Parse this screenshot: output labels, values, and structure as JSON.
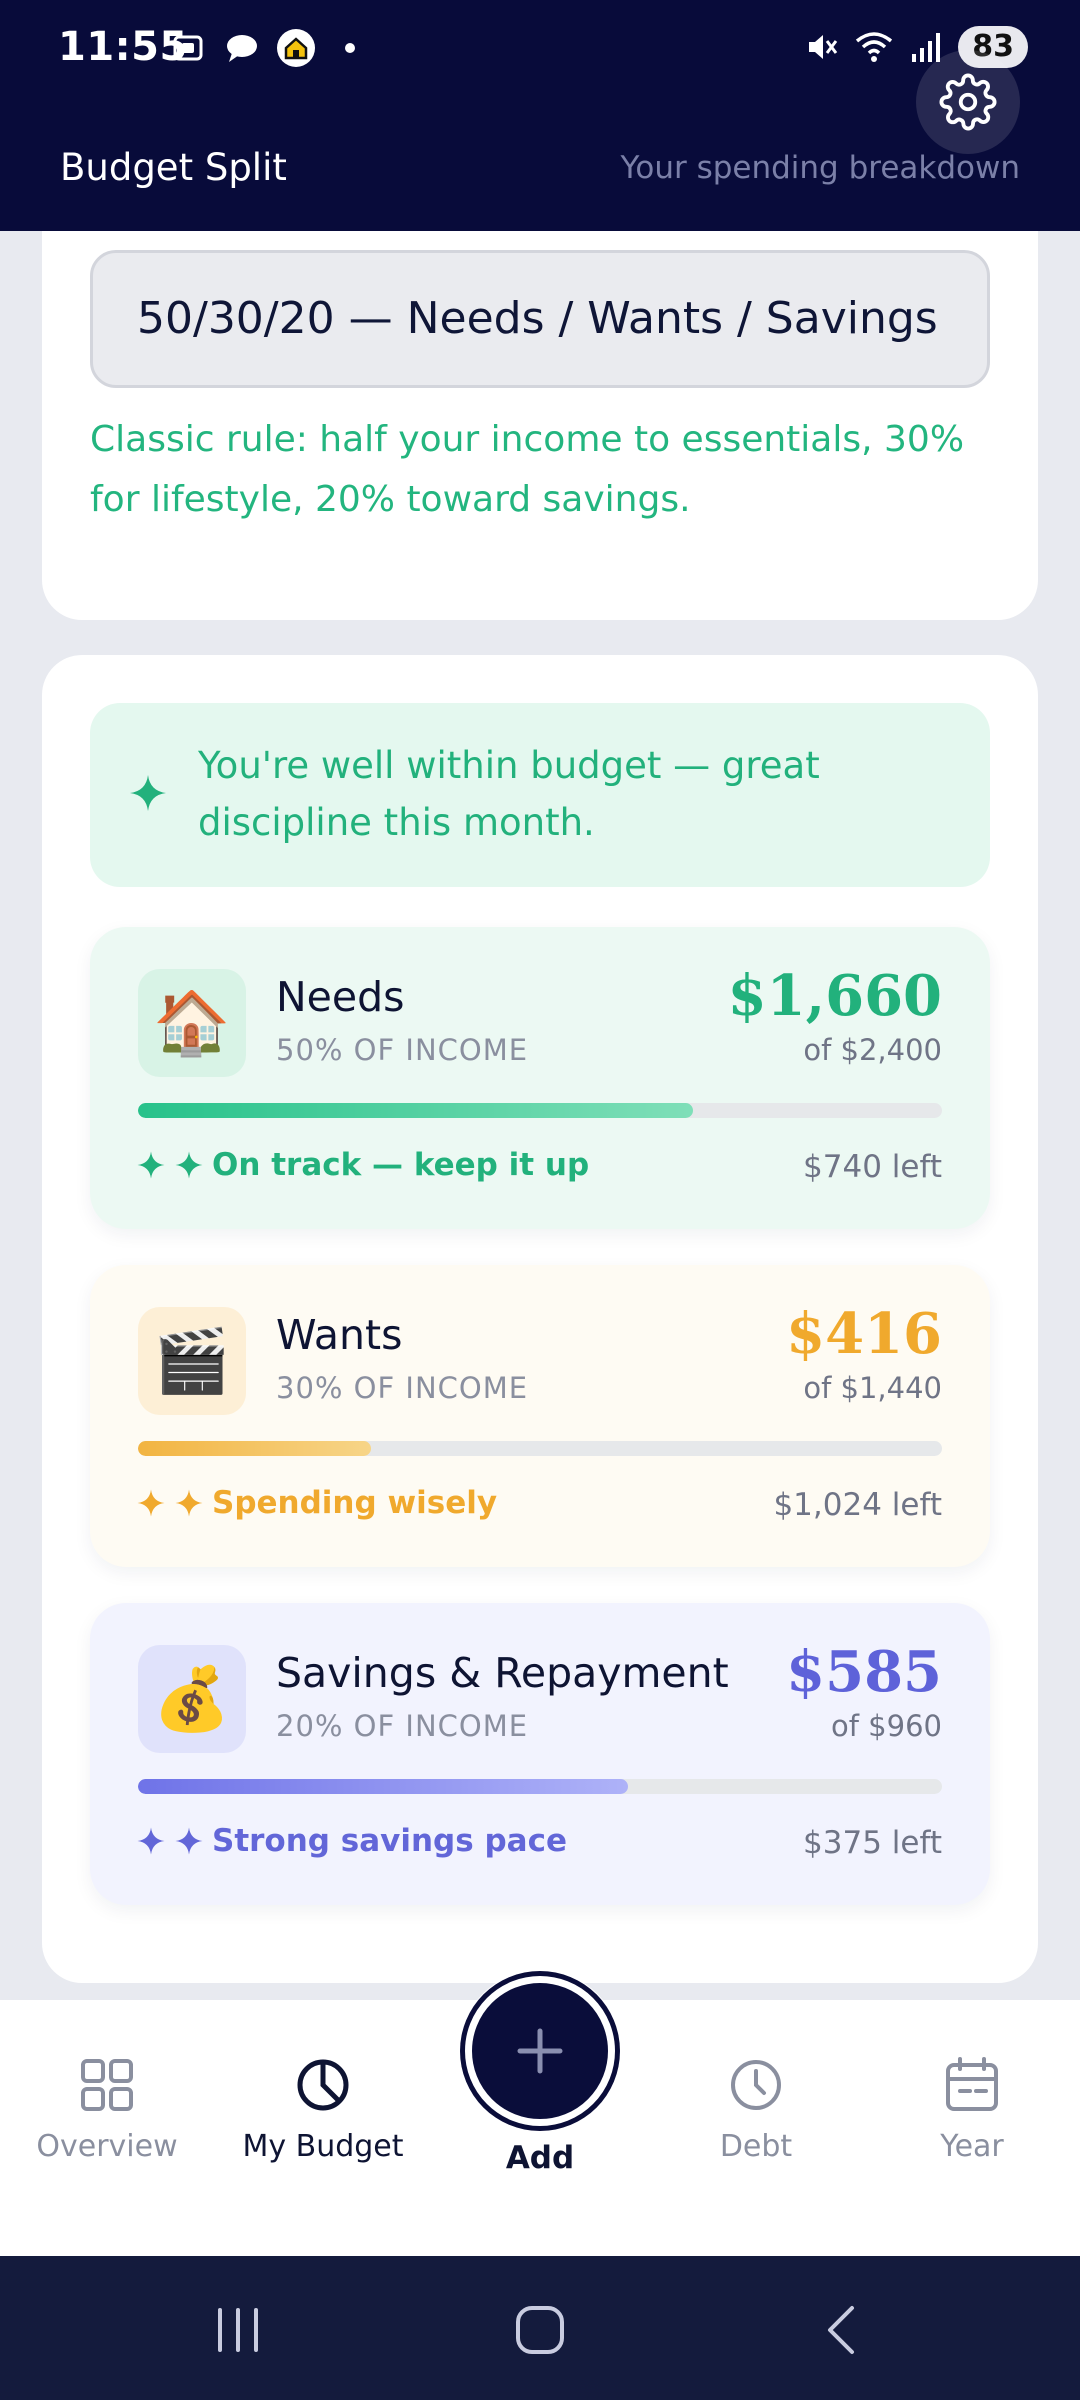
{
  "status_bar": {
    "time": "11:55",
    "battery": "83",
    "notification_icons": [
      "screenshot-icon",
      "chat-icon",
      "home-app-icon",
      "dot-icon"
    ],
    "system_icons": [
      "mute-icon",
      "wifi-icon",
      "signal-icon"
    ]
  },
  "header": {
    "title": "Budget Split",
    "subtitle": "Your spending breakdown",
    "settings_icon": "gear-icon"
  },
  "rule": {
    "selected": "50/30/20 — Needs / Wants / Savings",
    "description": "Classic rule: half your income to essentials, 30% for lifestyle, 20% toward savings."
  },
  "banner": {
    "icon": "sparkle-icon",
    "text": "You're well within budget — great discipline this month."
  },
  "categories": [
    {
      "name": "Needs",
      "emoji": "🏠",
      "percent_label": "50% OF INCOME",
      "spent": "$1,660",
      "budget": "of $2,400",
      "progress": 0.69,
      "status": "On track — keep it up",
      "left": "$740 left",
      "color": "#22b17c"
    },
    {
      "name": "Wants",
      "emoji": "🎬",
      "percent_label": "30% OF INCOME",
      "spent": "$416",
      "budget": "of $1,440",
      "progress": 0.29,
      "status": "Spending wisely",
      "left": "$1,024 left",
      "color": "#f0a92d"
    },
    {
      "name": "Savings & Repayment",
      "emoji": "💰",
      "percent_label": "20% OF INCOME",
      "spent": "$585",
      "budget": "of $960",
      "progress": 0.61,
      "status": "Strong savings pace",
      "left": "$375 left",
      "color": "#5e62d9"
    }
  ],
  "bottom_nav": {
    "items": [
      {
        "label": "Overview",
        "icon": "grid-icon",
        "active": false
      },
      {
        "label": "My Budget",
        "icon": "pie-clock-icon",
        "active": true
      },
      {
        "label": "Debt",
        "icon": "clock-icon",
        "active": false
      },
      {
        "label": "Year",
        "icon": "calendar-icon",
        "active": false
      }
    ],
    "add_label": "Add"
  },
  "system_nav": [
    "recents-icon",
    "home-icon",
    "back-icon"
  ]
}
